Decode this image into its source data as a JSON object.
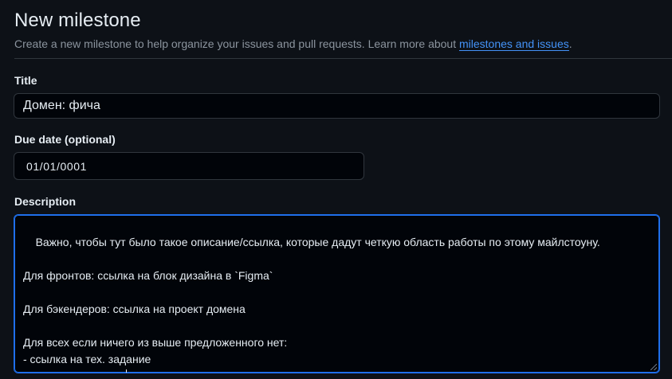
{
  "header": {
    "title": "New milestone",
    "subtitle_prefix": "Create a new milestone to help organize your issues and pull requests. Learn more about ",
    "subtitle_link": "milestones and issues",
    "subtitle_suffix": "."
  },
  "form": {
    "title_label": "Title",
    "title_value": "Домен: фича",
    "due_date_label": "Due date (optional)",
    "due_date_value": "01/01/0001",
    "description_label": "Description",
    "description_value": "Важно, чтобы тут было такое описание/ссылка, которые дадут четкую область работы по этому майлстоуну.\n\nДля фронтов: ссылка на блок дизайна в `Figma`\n\nДля бэкендеров: ссылка на проект домена\n\nДля всех если ничего из выше предложенного нет:\n- ссылка на тех. задание\n- описание словами"
  },
  "colors": {
    "background": "#0d1117",
    "input_background": "#010409",
    "border": "#30363d",
    "focus_border": "#1f6feb",
    "link": "#4493f8",
    "muted_text": "#8b949e"
  }
}
